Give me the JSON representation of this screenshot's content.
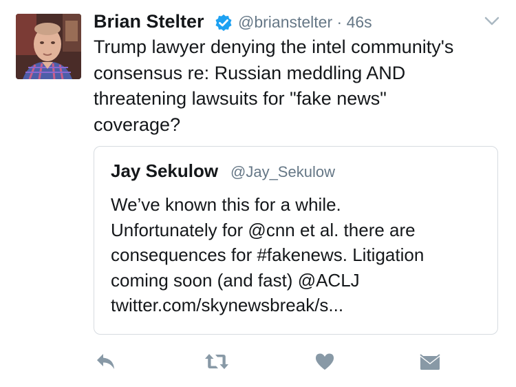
{
  "tweet": {
    "author_name": "Brian Stelter",
    "author_handle": "@brianstelter",
    "separator": "·",
    "time": "46s",
    "verified": true,
    "text_lines": [
      "Trump lawyer denying the intel community's",
      "consensus re: Russian meddling AND",
      "threatening lawsuits for \"fake news\"",
      "coverage?"
    ]
  },
  "quoted_tweet": {
    "author_name": "Jay Sekulow",
    "author_handle": "@Jay_Sekulow",
    "text_lines": [
      "We’ve known this for a while.",
      "Unfortunately for @cnn et al. there are",
      "consequences for #fakenews. Litigation",
      "coming soon (and fast) @ACLJ",
      "twitter.com/skynewsbreak/s..."
    ]
  },
  "actions": [
    {
      "icon": "reply-icon"
    },
    {
      "icon": "retweet-icon"
    },
    {
      "icon": "heart-icon"
    },
    {
      "icon": "direct-message-icon"
    }
  ],
  "colors": {
    "text": "#14171a",
    "secondary": "#657786",
    "verified_blue": "#1da1f2",
    "icon_gray": "#8899a6",
    "border": "#d6dbe0"
  }
}
